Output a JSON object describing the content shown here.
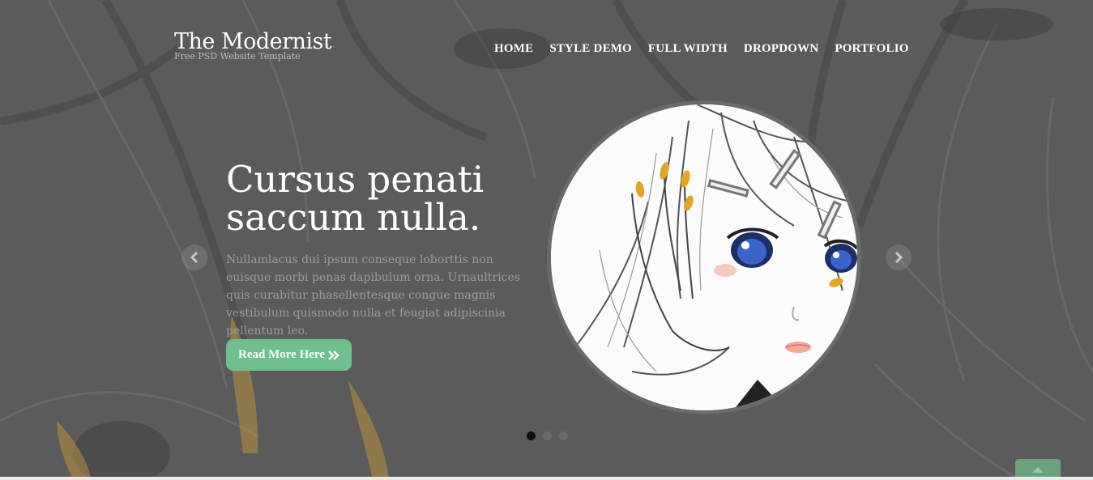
{
  "site": {
    "title": "The Modernist",
    "tagline": "Free PSD Website Template"
  },
  "nav": {
    "items": [
      {
        "label": "HOME"
      },
      {
        "label": "STYLE DEMO"
      },
      {
        "label": "FULL WIDTH"
      },
      {
        "label": "DROPDOWN"
      },
      {
        "label": "PORTFOLIO"
      }
    ]
  },
  "slider": {
    "heading_line1": "Cursus penati",
    "heading_line2": "saccum nulla.",
    "body": "Nullamlacus dui ipsum conseque loborttis non euisque morbi penas dapibulum orna. Urnaultrices quis curabitur phasellentesque congue magnis vestibulum quismodo nulla et feugiat adipiscinia pellentum leo.",
    "cta_label": "Read More Here",
    "cta_icon": "double-chevron-right-icon",
    "prev_icon": "chevron-left-icon",
    "next_icon": "chevron-right-icon",
    "active_slide": 1,
    "slide_count": 3
  },
  "colors": {
    "accent": "#6ec08c",
    "background": "#5a5a5a",
    "scroll_top": "#6aa27e"
  }
}
